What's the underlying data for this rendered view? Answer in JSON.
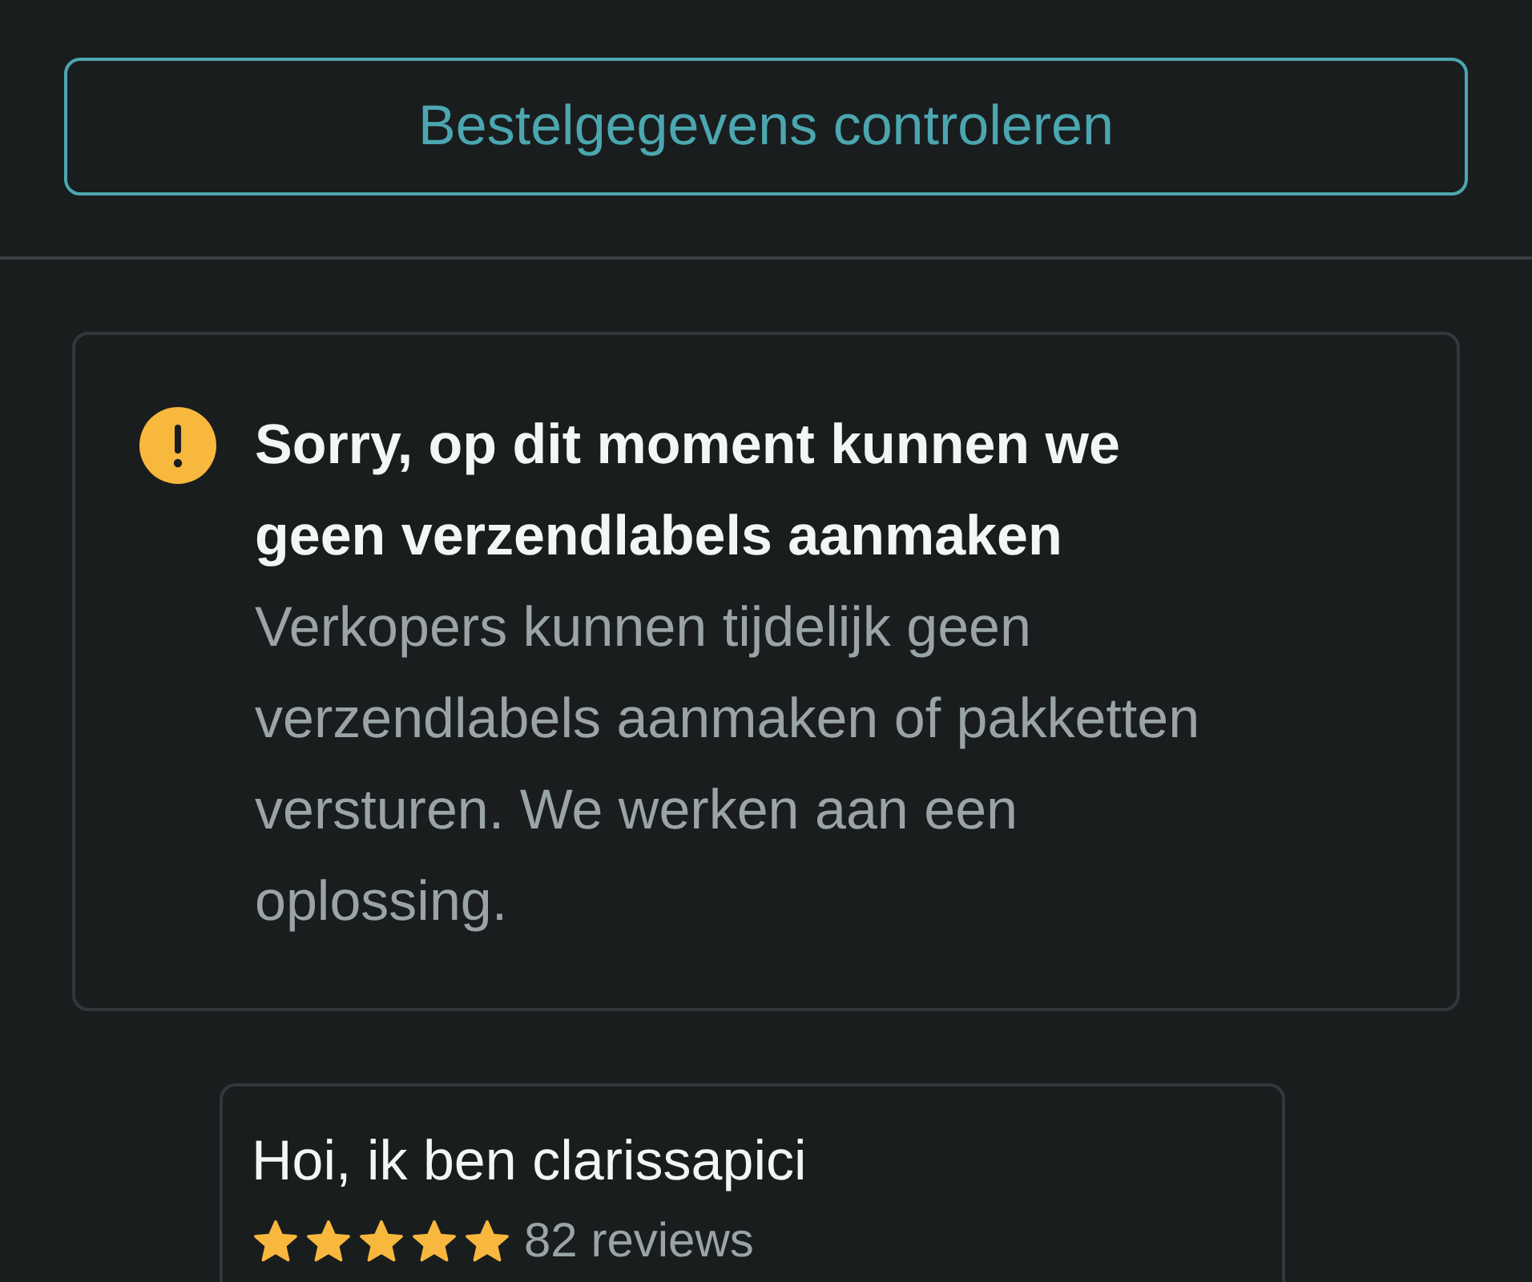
{
  "order_button": {
    "label": "Bestelgegevens controleren"
  },
  "alert": {
    "kind": "warning",
    "title": "Sorry, op dit moment kunnen we geen verzendlabels aanmaken",
    "message": "Verkopers kunnen tijdelijk geen verzendlabels aanmaken of pakketten versturen. We werken aan een oplossing."
  },
  "seller_card": {
    "greeting": "Hoi, ik ben clarissapici",
    "stars": 5,
    "reviews": "82 reviews"
  }
}
